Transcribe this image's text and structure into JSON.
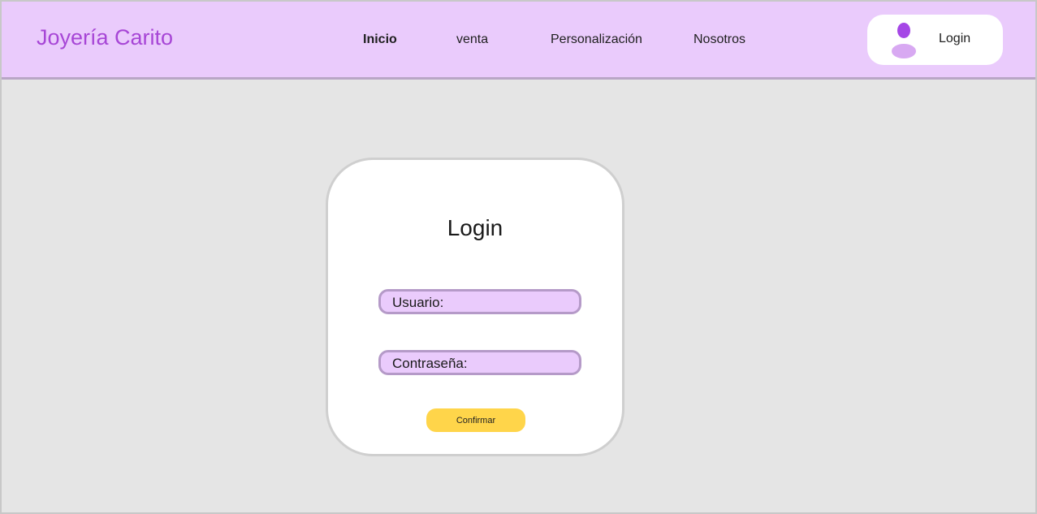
{
  "header": {
    "brand": "Joyería Carito",
    "nav": [
      {
        "label": "Inicio",
        "active": true
      },
      {
        "label": "venta",
        "active": false
      },
      {
        "label": "Personalización",
        "active": false
      },
      {
        "label": "Nosotros",
        "active": false
      }
    ],
    "login_button": {
      "label": "Login",
      "icon": "user-icon"
    }
  },
  "login_card": {
    "title": "Login",
    "username_field": {
      "label": "Usuario:"
    },
    "password_field": {
      "label": "Contraseña:"
    },
    "confirm_button": {
      "label": "Confirmar"
    }
  },
  "colors": {
    "header_bg": "#eacbfc",
    "brand": "#a746d6",
    "page_bg": "#e5e5e5",
    "field_bg": "#eacbfc",
    "field_border": "#b59ac8",
    "confirm_bg": "#ffd54a",
    "avatar_head": "#a547e6",
    "avatar_body": "#d8a9f2"
  }
}
